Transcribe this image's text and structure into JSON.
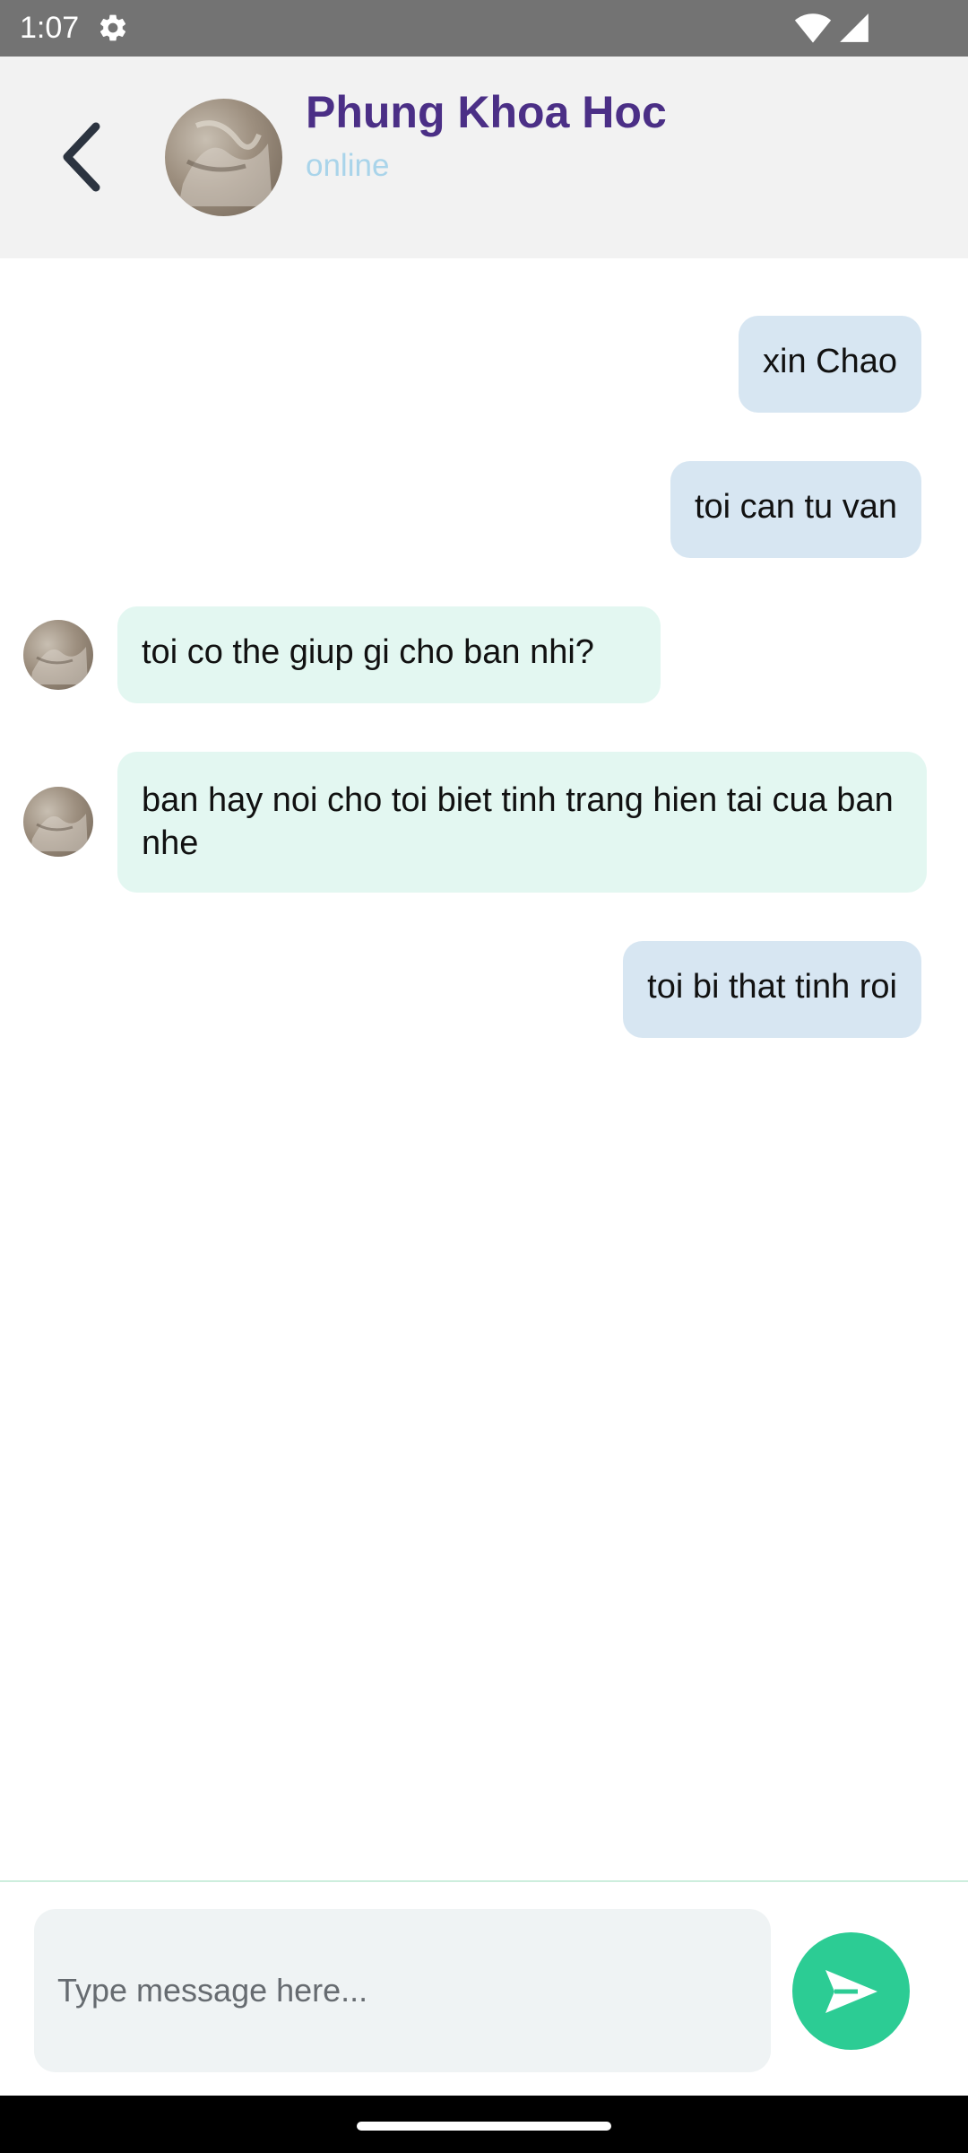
{
  "status_bar": {
    "time": "1:07",
    "settings_icon": "gear-icon",
    "wifi_icon": "wifi-icon",
    "signal_icon": "cell-signal-icon"
  },
  "header": {
    "back_icon": "chevron-left-icon",
    "contact_name": "Phung Khoa Hoc",
    "contact_status": "online"
  },
  "messages": [
    {
      "direction": "outgoing",
      "text": "xin Chao"
    },
    {
      "direction": "outgoing",
      "text": "toi can tu van"
    },
    {
      "direction": "incoming",
      "text": "toi co the giup gi cho ban nhi?"
    },
    {
      "direction": "incoming",
      "text": "ban hay noi cho toi biet tinh trang hien tai cua ban nhe"
    },
    {
      "direction": "outgoing",
      "text": "toi bi that tinh roi"
    }
  ],
  "composer": {
    "placeholder": "Type message here...",
    "value": "",
    "send_icon": "send-icon"
  },
  "colors": {
    "status_bar_bg": "#737373",
    "header_bg": "#f2f2f2",
    "contact_name": "#4b2f86",
    "contact_status": "#a9d4ea",
    "outgoing_bubble": "#d7e6f2",
    "incoming_bubble": "#e3f7f1",
    "send_button": "#2ccc94"
  }
}
